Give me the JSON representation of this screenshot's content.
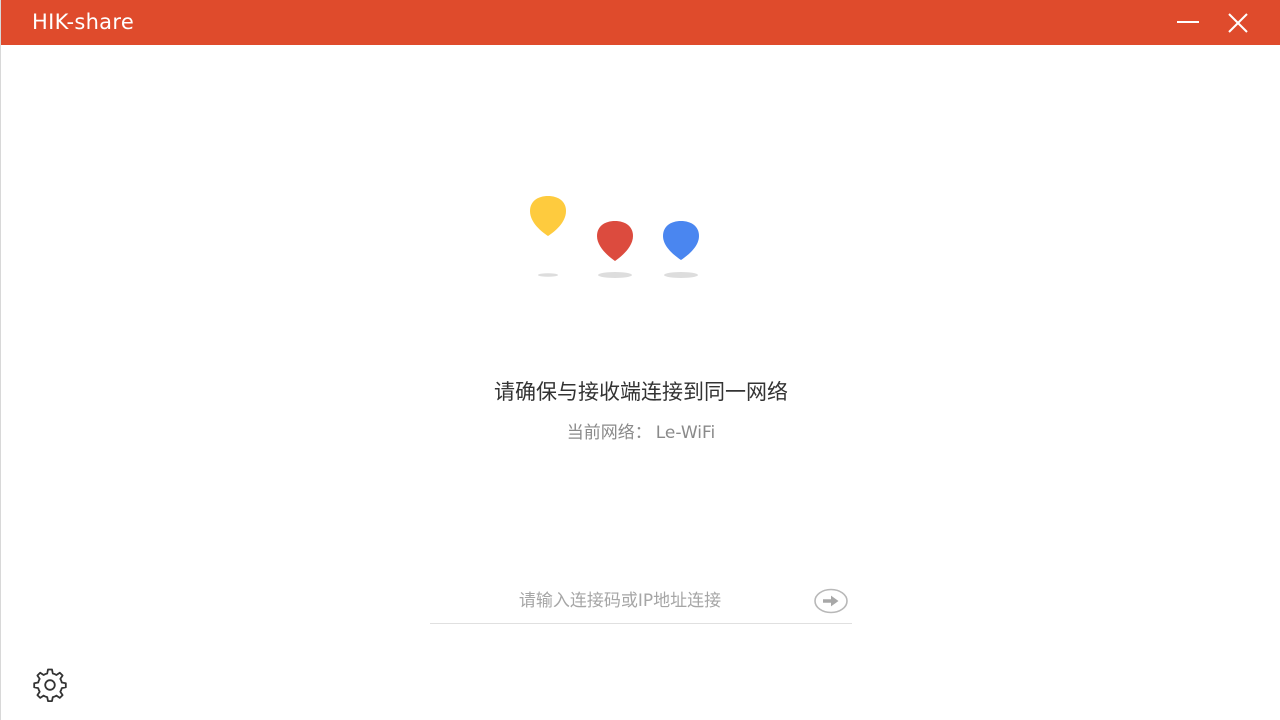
{
  "window": {
    "title": "HIK-share",
    "accent_color": "#df4b2c"
  },
  "icons": {
    "minimize": "minimize-icon",
    "close": "close-icon",
    "settings": "gear-icon",
    "go": "arrow-right-circle-icon"
  },
  "illustration": {
    "pins": [
      {
        "color": "#fecb3e"
      },
      {
        "color": "#dc4b3e"
      },
      {
        "color": "#4a86f0"
      }
    ]
  },
  "main": {
    "headline": "请确保与接收端连接到同一网络",
    "network_label": "当前网络：",
    "network_name": "Le-WiFi"
  },
  "connect": {
    "placeholder": "请输入连接码或IP地址连接",
    "value": ""
  }
}
